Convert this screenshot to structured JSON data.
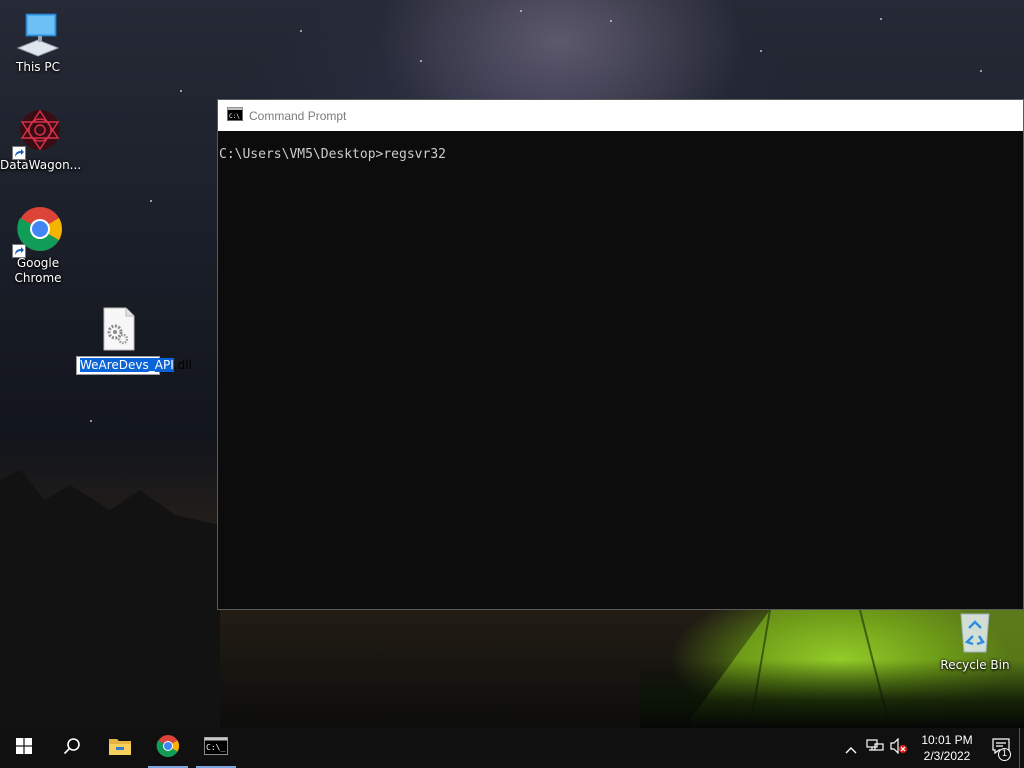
{
  "desktop": {
    "icons": [
      {
        "label": "This PC",
        "icon": "this-pc-icon"
      },
      {
        "label": "DataWagon...",
        "icon": "datawagon-icon"
      },
      {
        "label": "Google Chrome",
        "icon": "chrome-icon"
      },
      {
        "label": "Recycle Bin",
        "icon": "recycle-bin-icon"
      }
    ],
    "dll_file": {
      "icon": "dll-file-icon",
      "name_selected": "WeAreDevs_API",
      "name_rest": ".dll"
    }
  },
  "cmd_window": {
    "title": "Command Prompt",
    "lines": [
      "C:\\Users\\VM5\\Desktop>regsvr32"
    ]
  },
  "taskbar": {
    "buttons": [
      {
        "name": "start",
        "icon": "windows-logo-icon"
      },
      {
        "name": "search",
        "icon": "search-icon"
      },
      {
        "name": "file-explorer",
        "icon": "folder-icon"
      },
      {
        "name": "chrome",
        "icon": "chrome-icon"
      },
      {
        "name": "command-prompt",
        "icon": "cmd-icon"
      }
    ],
    "clock": {
      "time": "10:01 PM",
      "date": "2/3/2022"
    },
    "notification_count": "1"
  },
  "colors": {
    "selection": "#0a64d8",
    "taskbar": "#101010",
    "console_bg": "#0c0c0c",
    "console_text": "#cccccc"
  }
}
